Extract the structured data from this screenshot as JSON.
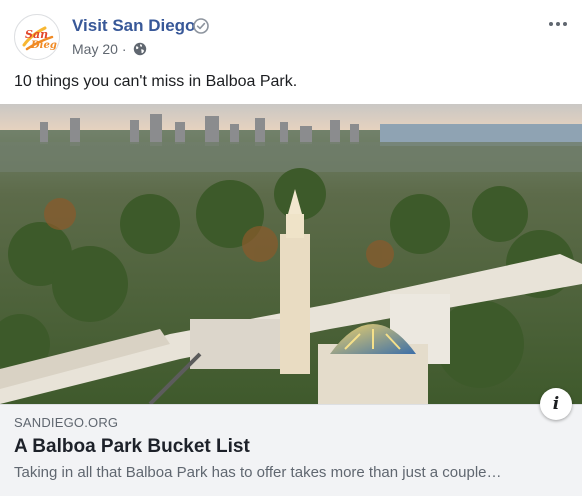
{
  "post": {
    "page_name": "Visit San Diego",
    "date": "May 20",
    "separator": "·",
    "audience_icon": "globe-icon",
    "verified_icon": "verified-badge-icon",
    "menu_icon": "more-options-icon",
    "text": "10 things you can't miss in Balboa Park."
  },
  "avatar": {
    "logo_text_1": "San",
    "logo_text_2": "Diego"
  },
  "link_preview": {
    "domain": "SANDIEGO.ORG",
    "title": "A Balboa Park Bucket List",
    "description": "Taking in all that Balboa Park has to offer takes more than just a couple…",
    "info_label": "i"
  },
  "colors": {
    "page_name": "#385898",
    "meta_text": "#606770",
    "link_box_bg": "#f2f3f5",
    "logo_orange": "#f08a24",
    "logo_red": "#e2452b"
  }
}
